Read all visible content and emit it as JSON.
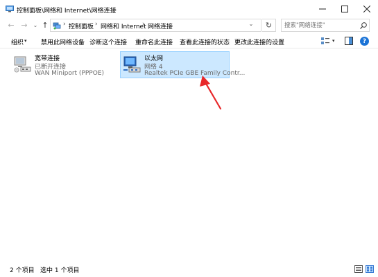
{
  "window": {
    "title": "控制面板\\网络和 Internet\\网络连接",
    "minimize_label": "—",
    "maximize_label": "☐",
    "close_label": "✕"
  },
  "address": {
    "crumbs": [
      "控制面板",
      "网络和 Internet",
      "网络连接"
    ],
    "separator": "›",
    "search_placeholder": "搜索\"网络连接\""
  },
  "nav": {
    "back": "←",
    "forward": "→",
    "recent": "⌄",
    "up": "↑",
    "refresh": "↻",
    "address_dropdown": "⌄"
  },
  "commands": {
    "organize": "组织",
    "organize_arrow": "▾",
    "disable": "禁用此网络设备",
    "diagnose": "诊断这个连接",
    "rename": "重命名此连接",
    "status": "查看此连接的状态",
    "settings": "更改此连接的设置",
    "view_arrow": "▾",
    "help": "?"
  },
  "items": [
    {
      "name": "宽带连接",
      "status": "已断开连接",
      "device": "WAN Miniport (PPPOE)",
      "icon": "broadband-connection-icon",
      "selected": false
    },
    {
      "name": "以太网",
      "status": "网络 4",
      "device": "Realtek PCIe GBE Family Contr...",
      "icon": "ethernet-connection-icon",
      "selected": true
    }
  ],
  "statusbar": {
    "count": "2 个项目",
    "selected": "选中 1 个项目"
  },
  "colors": {
    "selection_bg": "#cce8ff",
    "selection_border": "#99d1ff",
    "annotation_arrow": "#e8282a",
    "help_blue": "#1a73d6"
  }
}
